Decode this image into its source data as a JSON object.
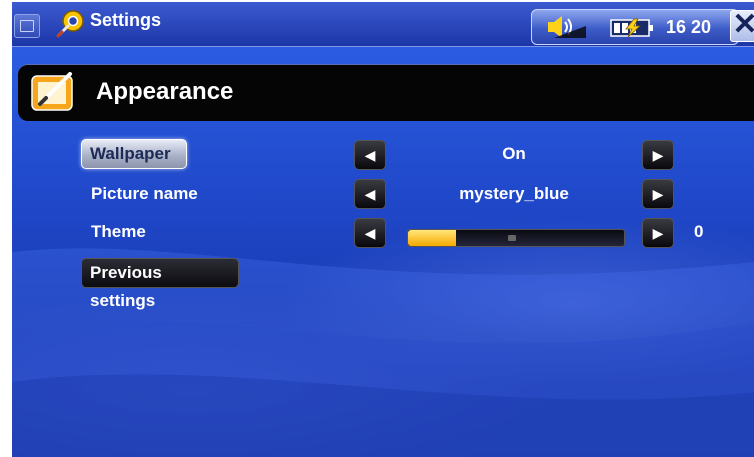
{
  "statusbar": {
    "title": "Settings",
    "clock": "16 20",
    "close_label": "✕"
  },
  "header": {
    "title": "Appearance"
  },
  "rows": [
    {
      "label": "Wallpaper",
      "value": "On",
      "selected": true
    },
    {
      "label": "Picture name",
      "value": "mystery_blue"
    },
    {
      "label": "Theme",
      "value": "0",
      "slider_fraction": 0.22
    }
  ],
  "previous_settings_label": "Previous settings",
  "icons": {
    "app": "app-square-icon",
    "settings": "settings-gear-icon",
    "volume": "volume-icon",
    "battery": "battery-charging-icon",
    "appearance": "appearance-brush-icon",
    "left": "arrow-left-icon",
    "right": "arrow-right-icon"
  },
  "colors": {
    "accent": "#f6a900",
    "background": "#1f47c8"
  }
}
